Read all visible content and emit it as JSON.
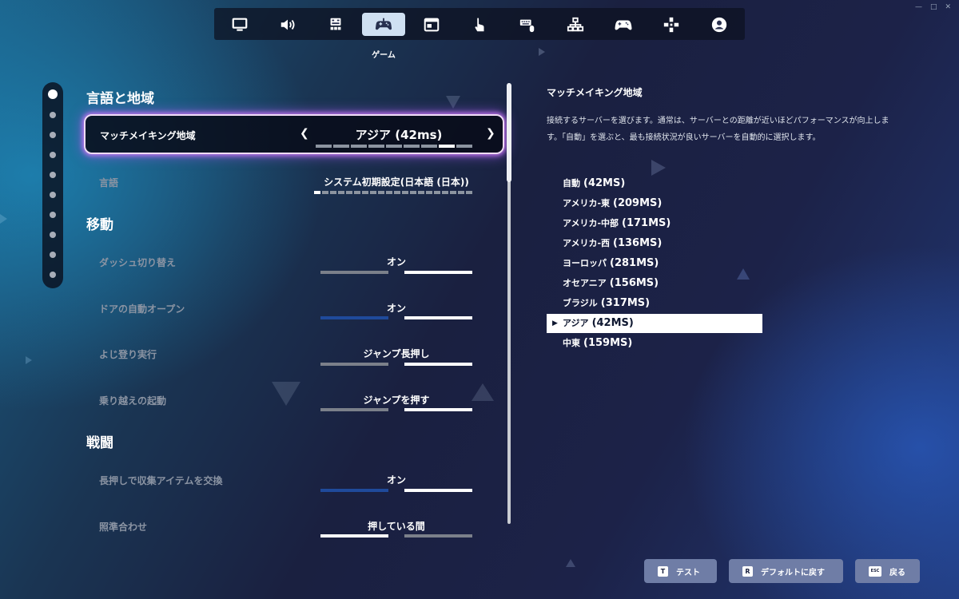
{
  "window": {
    "minimize": "—",
    "maximize": "□",
    "close": "✕"
  },
  "nav": {
    "tabs": [
      {
        "icon": "monitor-icon"
      },
      {
        "icon": "speaker-icon"
      },
      {
        "icon": "accessibility-grid-icon"
      },
      {
        "icon": "gamepad-icon"
      },
      {
        "icon": "hud-window-icon"
      },
      {
        "icon": "touch-hand-icon"
      },
      {
        "icon": "keyboard-mouse-icon"
      },
      {
        "icon": "network-icon"
      },
      {
        "icon": "controller-icon"
      },
      {
        "icon": "dpad-icon"
      },
      {
        "icon": "account-icon"
      }
    ],
    "active_index": 3,
    "active_caption": "ゲーム"
  },
  "rail": {
    "count": 12,
    "active_index": 0
  },
  "sections": {
    "region": "言語と地域",
    "movement": "移動",
    "combat": "戦闘"
  },
  "settings": {
    "matchmaking": {
      "label": "マッチメイキング地域",
      "value": "アジア (42ms)",
      "ticks_total": 9,
      "ticks_selected": 8
    },
    "language": {
      "label": "言語",
      "value": "システム初期設定(日本語 (日本))",
      "ticks_total": 20,
      "ticks_selected": 1
    },
    "dash_toggle": {
      "label": "ダッシュ切り替え",
      "value": "オン"
    },
    "auto_door": {
      "label": "ドアの自動オープン",
      "value": "オン"
    },
    "climb": {
      "label": "よじ登り実行",
      "value": "ジャンプ長押し"
    },
    "mantle": {
      "label": "乗り越えの起動",
      "value": "ジャンプを押す"
    },
    "hold_swap": {
      "label": "長押しで収集アイテムを交換",
      "value": "オン"
    },
    "aim": {
      "label": "照準合わせ",
      "value": "押している間"
    }
  },
  "details": {
    "title": "マッチメイキング地域",
    "description_line1": "接続するサーバーを選びます。通常は、サーバーとの距離が近いほどパフォーマンスが向上しま",
    "description_line2": "す。「自動」を選ぶと、最も接続状況が良いサーバーを自動的に選択します。",
    "options": [
      {
        "name": "自動",
        "ping": "(42MS)"
      },
      {
        "name": "アメリカ-東",
        "ping": "(209MS)"
      },
      {
        "name": "アメリカ-中部",
        "ping": "(171MS)"
      },
      {
        "name": "アメリカ-西",
        "ping": "(136MS)"
      },
      {
        "name": "ヨーロッパ",
        "ping": "(281MS)"
      },
      {
        "name": "オセアニア",
        "ping": "(156MS)"
      },
      {
        "name": "ブラジル",
        "ping": "(317MS)"
      },
      {
        "name": "アジア",
        "ping": "(42MS)"
      },
      {
        "name": "中東",
        "ping": "(159MS)"
      }
    ],
    "selected_index": 7
  },
  "buttons": {
    "test": {
      "key": "T",
      "label": "テスト"
    },
    "reset": {
      "key": "R",
      "label": "デフォルトに戻す"
    },
    "back": {
      "key": "ESC",
      "label": "戻る"
    }
  }
}
